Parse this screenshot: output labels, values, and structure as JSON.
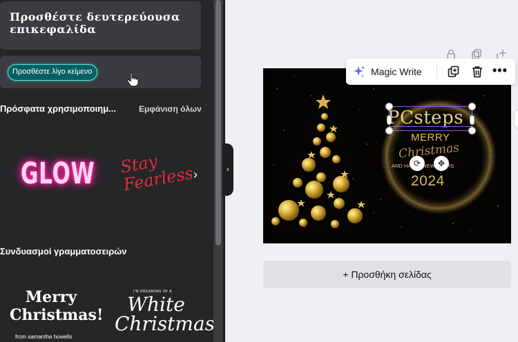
{
  "left_panel": {
    "heading_card": {
      "text": "Προσθέστε δευτερεύουσα επικεφαλίδα"
    },
    "text_card": {
      "text": "Προσθέστε λίγο κείμενο"
    },
    "recent": {
      "title": "Πρόσφατα χρησιμοποιημ...",
      "see_all": "Εμφάνιση όλων",
      "items": [
        {
          "text": "GLOW"
        },
        {
          "text": "Stay Fearless"
        }
      ]
    },
    "font_combos": {
      "title": "Συνδυασμοί γραμματοσειρών",
      "items": [
        {
          "text": "Merry Christmas!",
          "subtext": "from samantha howells"
        },
        {
          "text": "White Christmas",
          "small_text": "I'M DREAMING OF A"
        }
      ]
    }
  },
  "toolbar": {
    "magic_write_label": "Magic Write",
    "icons": [
      "sparkle-icon",
      "duplicate-icon",
      "trash-icon",
      "more-icon"
    ]
  },
  "canvas": {
    "brand_text": "PCsteps",
    "merry": "MERRY",
    "christmas": "Christmas",
    "new_year_line": "AND HAPPY NEW YEARS",
    "year": "2024"
  },
  "add_page": {
    "label": "+ Προσθήκη σελίδας"
  },
  "colors": {
    "panel_bg": "#252627",
    "card_bg": "#3a3c3f",
    "accent_teal": "#46e7dc",
    "selection_purple": "#8a5cf6",
    "gold": "#e7cf8c",
    "workspace_bg": "#eef0f3"
  }
}
